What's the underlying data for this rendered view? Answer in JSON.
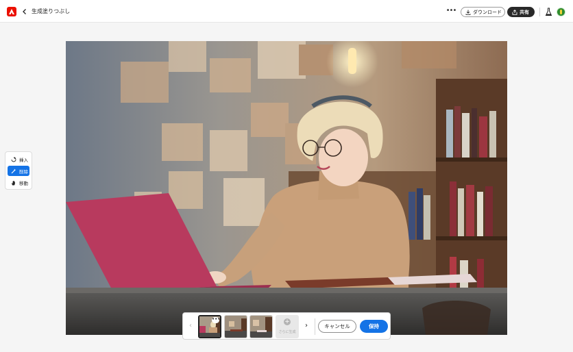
{
  "header": {
    "title": "生成塗りつぶし",
    "more_label": "•••",
    "download_label": "ダウンロード",
    "share_label": "共有"
  },
  "tools": [
    {
      "label": "挿入",
      "icon": "insert-icon",
      "active": false
    },
    {
      "label": "削除",
      "icon": "remove-icon",
      "active": true
    },
    {
      "label": "移動",
      "icon": "hand-icon",
      "active": false
    }
  ],
  "generation_bar": {
    "thumb_more_label": "•••",
    "generate_more_label": "さらに生成",
    "generate_more_icon": "+",
    "prev_label": "‹",
    "next_label": "›",
    "cancel_label": "キャンセル",
    "keep_label": "保持"
  },
  "colors": {
    "accent": "#1473e6",
    "brand": "#eb1000",
    "share_bg": "#292929"
  }
}
